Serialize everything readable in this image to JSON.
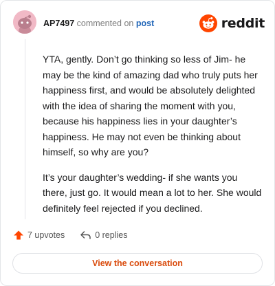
{
  "comment": {
    "author": "AP7497",
    "action_text": "commented on",
    "target_link": "post",
    "paragraphs": [
      "YTA, gently. Don’t go thinking so less of Jim- he may be the kind of amazing dad who truly puts her happiness first, and would be absolutely delighted with the idea of sharing the moment with you, because his happiness lies in your daughter’s happiness. He may not even be thinking about himself, so why are you?",
      "It’s your daughter’s wedding- if she wants you there, just go. It would mean a lot to her. She would definitely feel rejected if you declined."
    ]
  },
  "brand": {
    "name": "reddit",
    "icon": "reddit-logo-icon",
    "color": "#ff4500"
  },
  "actions": {
    "upvotes": "7 upvotes",
    "replies": "0 replies"
  },
  "cta": {
    "label": "View the conversation",
    "color": "#d94a0b"
  },
  "colors": {
    "avatar_bg": "#f1b9c6",
    "link": "#2166b8",
    "upvote": "#ff4500"
  }
}
